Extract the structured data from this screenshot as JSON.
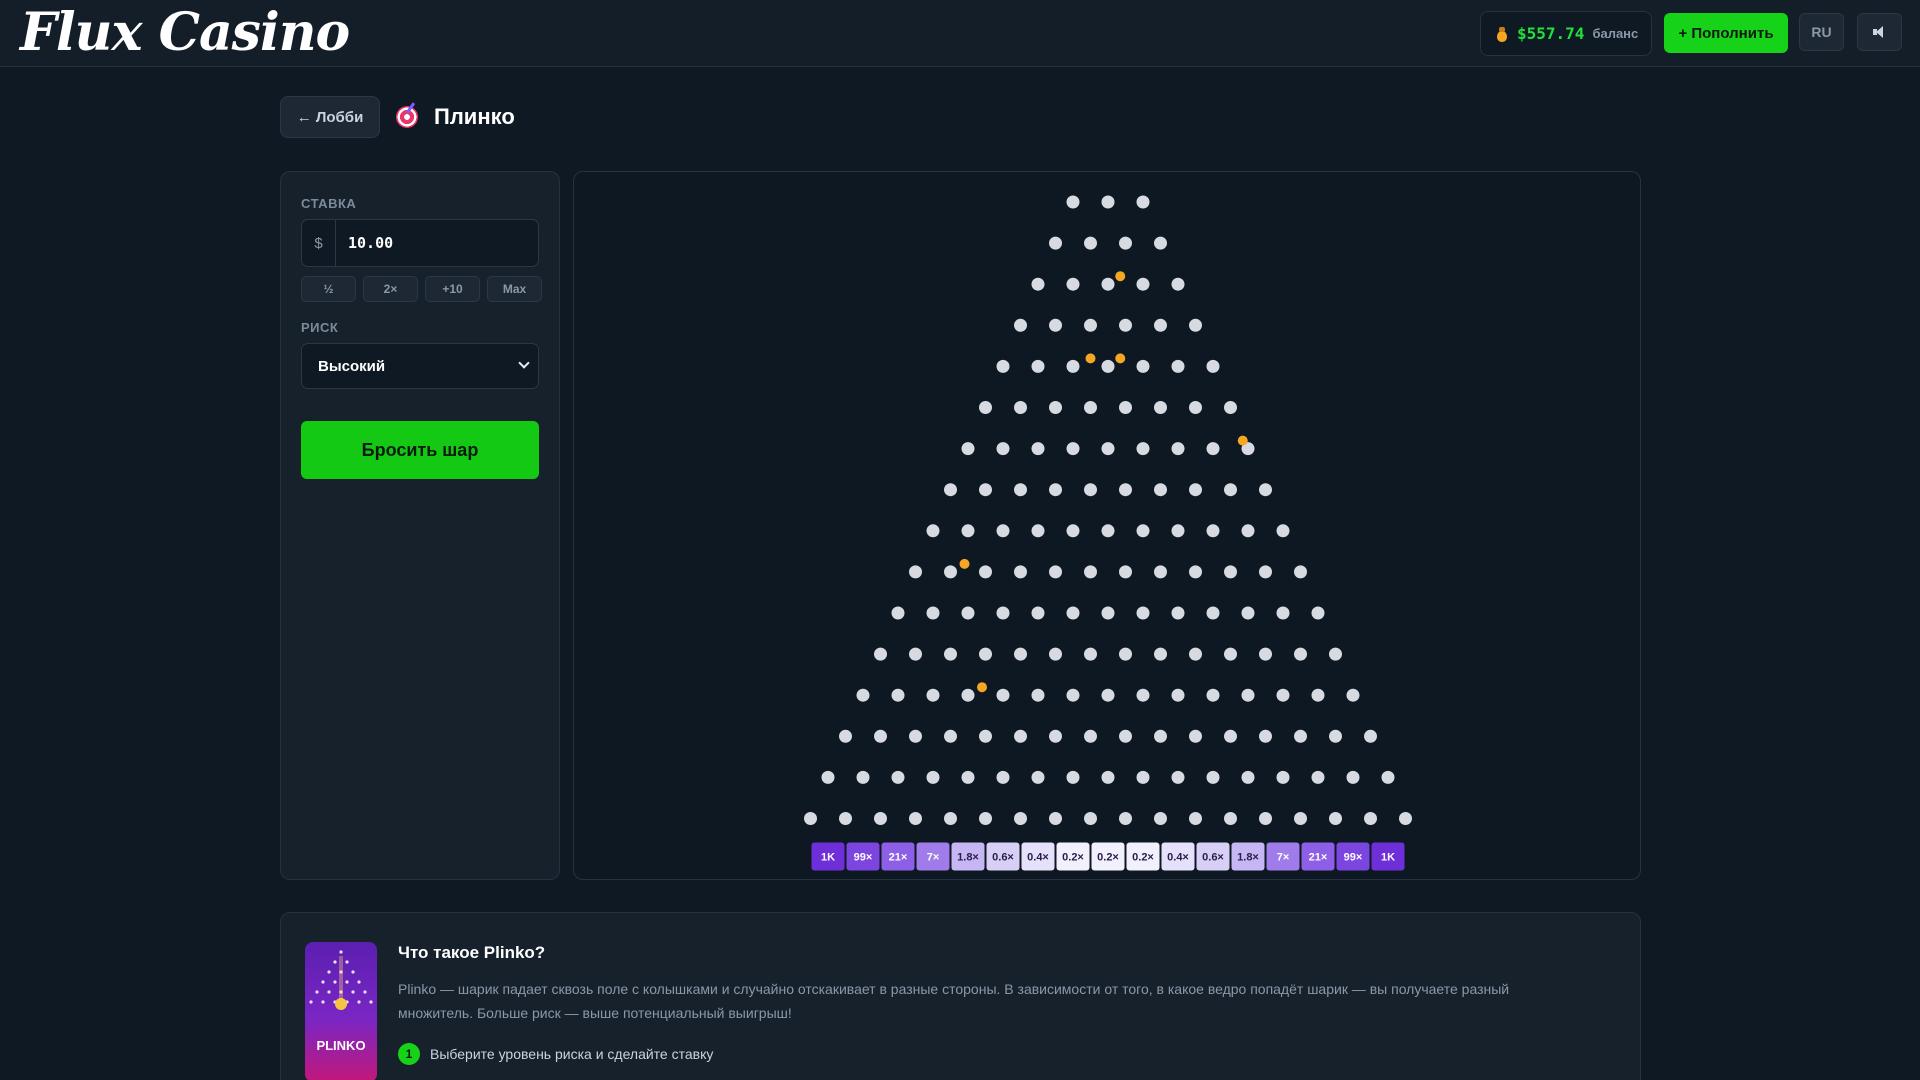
{
  "header": {
    "logo": "Flux Casino",
    "balance_amount": "$557.74",
    "balance_label": "баланс",
    "deposit_label": "+ Пополнить",
    "lang_label": "RU"
  },
  "title_bar": {
    "back_label": "← Лобби",
    "page_title": "Плинко"
  },
  "controls": {
    "bet_label": "СТАВКА",
    "currency": "$",
    "bet_value": "10.00",
    "quick_buttons": [
      "½",
      "2×",
      "+10",
      "Max"
    ],
    "risk_label": "РИСК",
    "risk_value": "Высокий",
    "drop_button": "Бросить шар"
  },
  "board": {
    "rows": 16,
    "top_pegs": 3,
    "multipliers": [
      "1K",
      "99×",
      "21×",
      "7×",
      "1.8×",
      "0.6×",
      "0.4×",
      "0.2×",
      "0.2×",
      "0.2×",
      "0.4×",
      "0.6×",
      "1.8×",
      "7×",
      "21×",
      "99×",
      "1K"
    ],
    "bucket_colors": [
      "#6e2fd8",
      "#7c45e0",
      "#8d5ee6",
      "#a07ceb",
      "#c6b6f3",
      "#d8cff7",
      "#e6e1fa",
      "#f2f0fc",
      "#f2f0fc",
      "#f2f0fc",
      "#e6e1fa",
      "#d8cff7",
      "#c6b6f3",
      "#a07ceb",
      "#8d5ee6",
      "#7c45e0",
      "#6e2fd8"
    ],
    "peg_color": "#d7dbe1",
    "ball_color": "#f5a623",
    "balls": [
      {
        "row": 2,
        "slot": 2.35
      },
      {
        "row": 4,
        "slot": 2.5
      },
      {
        "row": 4,
        "slot": 3.35
      },
      {
        "row": 6,
        "slot": 7.85
      },
      {
        "row": 9,
        "slot": 1.4
      },
      {
        "row": 12,
        "slot": 3.4
      }
    ]
  },
  "info": {
    "thumb_label": "PLINKO",
    "title": "Что такое Plinko?",
    "description": "Plinko — шарик падает сквозь поле с колышками и случайно отскакивает в разные стороны. В зависимости от того, в какое ведро попадёт шарик — вы получаете разный множитель. Больше риск — выше потенциальный выигрыш!",
    "step_number": "1",
    "step_text": "Выберите уровень риска и сделайте ставку"
  }
}
